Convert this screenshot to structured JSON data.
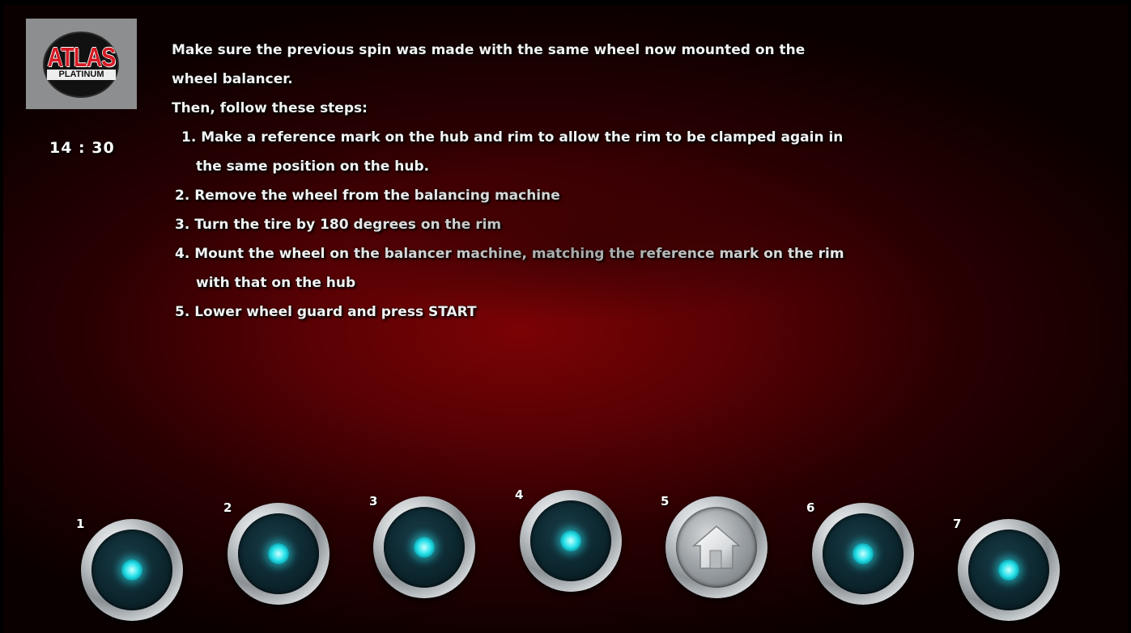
{
  "brand": {
    "logo_word": "ATLAS",
    "logo_sub": "PLATINUM"
  },
  "clock": {
    "time": "14 : 30"
  },
  "instructions": {
    "intro_line1": "Make sure the previous spin was made with the same wheel now mounted on the",
    "intro_line2": "wheel balancer.",
    "then": "Then, follow these steps:",
    "steps": [
      {
        "line1": "1. Make a reference mark on the hub and rim to allow the rim to be clamped again in",
        "line2": "the same position on the hub."
      },
      {
        "line1": "2. Remove the wheel from the balancing machine"
      },
      {
        "line1": "3. Turn the tire by 180 degrees on the rim"
      },
      {
        "line1": "4. Mount the wheel on the balancer machine, matching the reference mark on the rim",
        "line2": "with that on the hub"
      },
      {
        "line1": "5. Lower wheel guard and press START"
      }
    ]
  },
  "buttons": [
    {
      "number": "1",
      "icon": "indicator-light-icon"
    },
    {
      "number": "2",
      "icon": "indicator-light-icon"
    },
    {
      "number": "3",
      "icon": "indicator-light-icon"
    },
    {
      "number": "4",
      "icon": "indicator-light-icon"
    },
    {
      "number": "5",
      "icon": "home-icon"
    },
    {
      "number": "6",
      "icon": "indicator-light-icon"
    },
    {
      "number": "7",
      "icon": "indicator-light-icon"
    }
  ],
  "colors": {
    "accent_cyan": "#29e2ea",
    "background_red": "#7a0205",
    "brand_red": "#d51a24"
  }
}
